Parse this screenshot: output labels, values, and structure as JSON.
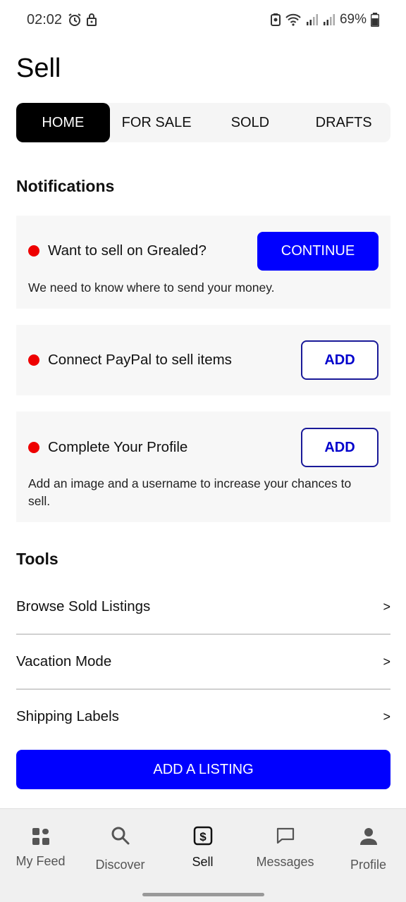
{
  "status_bar": {
    "time": "02:02",
    "battery": "69%",
    "icons": [
      "alarm-icon",
      "lock-icon",
      "battery-saver-icon",
      "wifi-icon",
      "signal-icon",
      "signal-icon",
      "battery-icon"
    ]
  },
  "header": {
    "title": "Sell"
  },
  "tabs": [
    {
      "label": "HOME",
      "active": true
    },
    {
      "label": "FOR SALE",
      "active": false
    },
    {
      "label": "SOLD",
      "active": false
    },
    {
      "label": "DRAFTS",
      "active": false
    }
  ],
  "notifications": {
    "heading": "Notifications",
    "items": [
      {
        "title": "Want to sell on Grealed?",
        "description": "We need to know where to send your money.",
        "action": "CONTINUE"
      },
      {
        "title": "Connect PayPal to sell items",
        "action": "ADD"
      },
      {
        "title": "Complete Your Profile",
        "description": "Add an image and a username to increase your chances to sell.",
        "action": "ADD"
      }
    ]
  },
  "tools": {
    "heading": "Tools",
    "items": [
      {
        "label": "Browse Sold Listings",
        "chevron": ">"
      },
      {
        "label": "Vacation Mode",
        "chevron": ">"
      },
      {
        "label": "Shipping Labels",
        "chevron": ">"
      }
    ]
  },
  "add_listing_label": "ADD A LISTING",
  "bottom_nav": [
    {
      "label": "My Feed",
      "icon": "grid-icon"
    },
    {
      "label": "Discover",
      "icon": "search-icon"
    },
    {
      "label": "Sell",
      "icon": "dollar-tag-icon",
      "active": true
    },
    {
      "label": "Messages",
      "icon": "chat-bubble-icon"
    },
    {
      "label": "Profile",
      "icon": "person-icon"
    }
  ],
  "colors": {
    "accent": "#0000ff",
    "notification_dot": "#ee0000",
    "tab_active_bg": "#000000",
    "card_bg": "#f7f7f7",
    "nav_bg": "#f0f0f0"
  }
}
